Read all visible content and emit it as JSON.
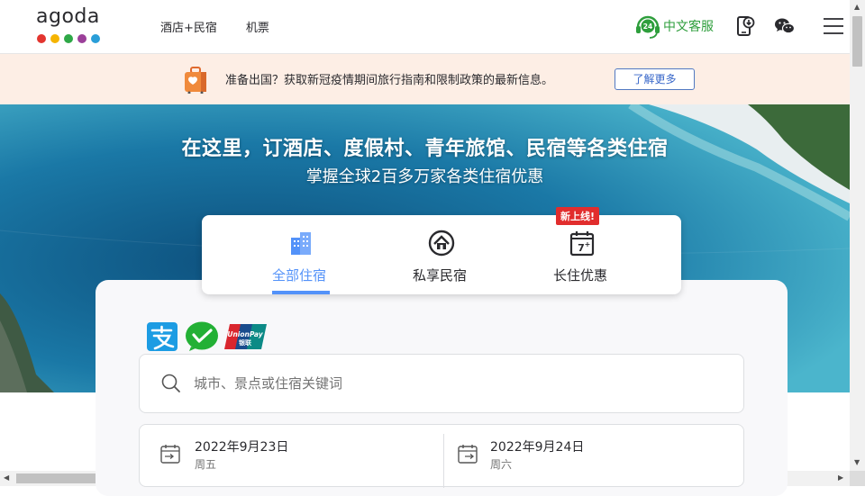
{
  "header": {
    "logo_text": "agoda",
    "logo_dot_colors": [
      "#e3352f",
      "#f5b400",
      "#2ea847",
      "#9b3f99",
      "#2a9ed8"
    ],
    "nav": [
      "酒店+民宿",
      "机票"
    ],
    "customer_service": "中文客服",
    "customer_service_color": "#2e9e3c"
  },
  "notice": {
    "text": "准备出国？获取新冠疫情期间旅行指南和限制政策的最新信息。",
    "button": "了解更多"
  },
  "hero": {
    "title": "在这里，订酒店、度假村、青年旅馆、民宿等各类住宿",
    "subtitle": "掌握全球2百多万家各类住宿优惠"
  },
  "tabs": [
    {
      "label": "全部住宿",
      "icon": "building-icon",
      "active": true
    },
    {
      "label": "私享民宿",
      "icon": "home-icon",
      "active": false
    },
    {
      "label": "长住优惠",
      "icon": "calendar-7plus-icon",
      "active": false,
      "badge": "新上线!"
    }
  ],
  "accent_color": "#5392f9",
  "payment_icons": [
    "alipay-icon",
    "wechat-pay-icon",
    "unionpay-icon"
  ],
  "unionpay_text": "UnionPay",
  "unionpay_cn": "银联",
  "search": {
    "placeholder": "城市、景点或住宿关键词"
  },
  "checkin": {
    "date": "2022年9月23日",
    "weekday": "周五"
  },
  "checkout": {
    "date": "2022年9月24日",
    "weekday": "周六"
  }
}
